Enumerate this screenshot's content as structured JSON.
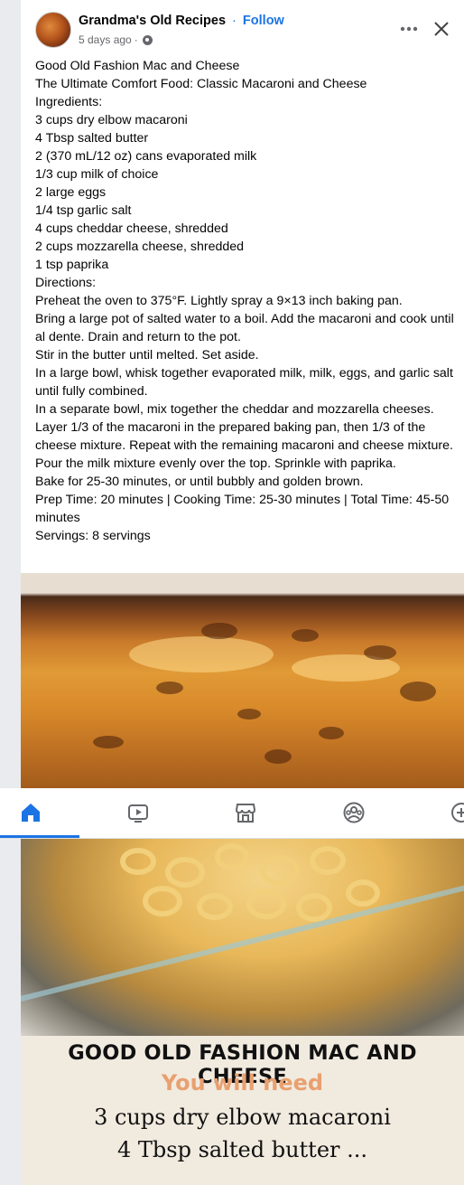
{
  "post": {
    "page_name": "Grandma's Old Recipes",
    "separator": "·",
    "follow_label": "Follow",
    "timestamp": "5 days ago",
    "meta_separator": "·",
    "more_icon": "more-horizontal-icon",
    "close_icon": "close-icon"
  },
  "text_lines": [
    "Good Old Fashion Mac and Cheese",
    "The Ultimate Comfort Food: Classic Macaroni and Cheese",
    "Ingredients:",
    "3 cups dry elbow macaroni",
    "4 Tbsp salted butter",
    "2 (370 mL/12 oz) cans evaporated milk",
    "1/3 cup milk of choice",
    "2 large eggs",
    "1/4 tsp garlic salt",
    "4 cups cheddar cheese, shredded",
    "2 cups mozzarella cheese, shredded",
    "1 tsp paprika",
    "Directions:",
    "Preheat the oven to 375°F. Lightly spray a 9×13 inch baking pan.",
    "Bring a large pot of salted water to a boil. Add the macaroni and cook until al dente. Drain and return to the pot.",
    "Stir in the butter until melted. Set aside.",
    "In a large bowl, whisk together evaporated milk, milk, eggs, and garlic salt until fully combined.",
    "In a separate bowl, mix together the cheddar and mozzarella cheeses.",
    "Layer 1/3 of the macaroni in the prepared baking pan, then 1/3 of the cheese mixture. Repeat with the remaining macaroni and cheese mixture.",
    "Pour the milk mixture evenly over the top. Sprinkle with paprika.",
    "Bake for 25-30 minutes, or until bubbly and golden brown.",
    "Prep Time: 20 minutes | Cooking Time: 25-30 minutes | Total Time: 45-50 minutes",
    "Servings: 8 servings"
  ],
  "nav": {
    "items": [
      {
        "icon": "home-icon",
        "active": true
      },
      {
        "icon": "video-icon",
        "active": false
      },
      {
        "icon": "marketplace-icon",
        "active": false
      },
      {
        "icon": "groups-icon",
        "active": false
      },
      {
        "icon": "add-icon",
        "active": false
      }
    ],
    "accent": "#1b74e4"
  },
  "image_card": {
    "title": "GOOD OLD FASHION MAC AND CHEESE",
    "subtitle": "You will need",
    "line1": "3 cups dry elbow macaroni",
    "line2": "4 Tbsp salted butter ..."
  },
  "colors": {
    "link": "#1b74e4",
    "secondary_text": "#65676b",
    "subtitle": "#e8a070"
  }
}
